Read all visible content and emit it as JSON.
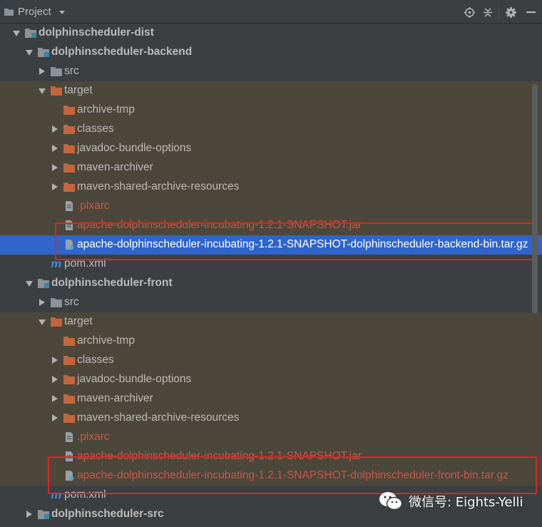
{
  "header": {
    "title": "Project",
    "icons": [
      "locate-icon",
      "collapse-all-icon",
      "settings-gear-icon",
      "hide-icon"
    ]
  },
  "tree": [
    {
      "label": "dolphinscheduler-dist",
      "kind": "module",
      "expanded": true
    },
    {
      "label": "dolphinscheduler-backend",
      "kind": "module",
      "expanded": true
    },
    {
      "label": "src",
      "kind": "folder-gray",
      "expanded": false
    },
    {
      "label": "target",
      "kind": "folder-orange",
      "expanded": true
    },
    {
      "label": "archive-tmp",
      "kind": "folder-orange"
    },
    {
      "label": "classes",
      "kind": "folder-orange",
      "expanded": false
    },
    {
      "label": "javadoc-bundle-options",
      "kind": "folder-orange",
      "expanded": false
    },
    {
      "label": "maven-archiver",
      "kind": "folder-orange",
      "expanded": false
    },
    {
      "label": "maven-shared-archive-resources",
      "kind": "folder-orange",
      "expanded": false
    },
    {
      "label": ".plxarc",
      "kind": "file"
    },
    {
      "label": "apache-dolphinscheduler-incubating-1.2.1-SNAPSHOT.jar",
      "kind": "file"
    },
    {
      "label": "apache-dolphinscheduler-incubating-1.2.1-SNAPSHOT-dolphinscheduler-backend-bin.tar.gz",
      "kind": "archive",
      "selected": true
    },
    {
      "label": "pom.xml",
      "kind": "maven"
    },
    {
      "label": "dolphinscheduler-front",
      "kind": "module",
      "expanded": true
    },
    {
      "label": "src",
      "kind": "folder-gray",
      "expanded": false
    },
    {
      "label": "target",
      "kind": "folder-orange",
      "expanded": true
    },
    {
      "label": "archive-tmp",
      "kind": "folder-orange"
    },
    {
      "label": "classes",
      "kind": "folder-orange",
      "expanded": false
    },
    {
      "label": "javadoc-bundle-options",
      "kind": "folder-orange",
      "expanded": false
    },
    {
      "label": "maven-archiver",
      "kind": "folder-orange",
      "expanded": false
    },
    {
      "label": "maven-shared-archive-resources",
      "kind": "folder-orange",
      "expanded": false
    },
    {
      "label": ".plxarc",
      "kind": "file"
    },
    {
      "label": "apache-dolphinscheduler-incubating-1.2.1-SNAPSHOT.jar",
      "kind": "file"
    },
    {
      "label": "apache-dolphinscheduler-incubating-1.2.1-SNAPSHOT-dolphinscheduler-front-bin.tar.gz",
      "kind": "archive"
    },
    {
      "label": "pom.xml",
      "kind": "maven"
    },
    {
      "label": "dolphinscheduler-src",
      "kind": "module",
      "expanded": false
    }
  ],
  "watermark": "微信号: Eights-Yelli",
  "colors": {
    "background": "#3c3f41",
    "excluded_background": "#4b473a",
    "selection": "#2f65ca",
    "excluded_text": "#c9574b",
    "highlight_box": "#e0251d",
    "folder_orange": "#c4663d",
    "folder_gray": "#8c9297"
  }
}
